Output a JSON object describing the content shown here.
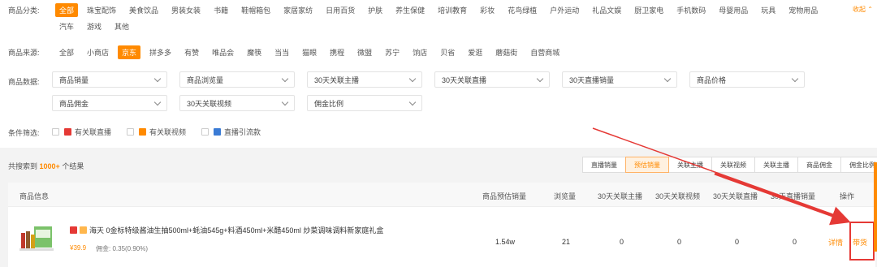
{
  "categories": {
    "label": "商品分类:",
    "row1": [
      "全部",
      "珠宝配饰",
      "美食饮品",
      "男装女装",
      "书籍",
      "鞋帽箱包",
      "家居家纺",
      "日用百货",
      "护肤",
      "养生保健",
      "培训教育",
      "彩妆",
      "花鸟绿植",
      "户外运动",
      "礼品文娱",
      "厨卫家电",
      "手机数码",
      "母婴用品",
      "玩具",
      "宠物用品"
    ],
    "row2": [
      "汽车",
      "游戏",
      "其他"
    ],
    "collapse": "收起 ⌃"
  },
  "sources": {
    "label": "商品来源:",
    "items": [
      "全部",
      "小商店",
      "京东",
      "拼多多",
      "有赞",
      "唯品会",
      "魔筷",
      "当当",
      "猫眼",
      "携程",
      "微盟",
      "苏宁",
      "饷店",
      "贝省",
      "爱逛",
      "蘑菇街",
      "自营商城"
    ]
  },
  "data_filters": {
    "label": "商品数据:",
    "selects": [
      "商品销量",
      "商品浏览量",
      "30天关联主播",
      "30天关联直播",
      "30天直播销量",
      "商品价格",
      "商品佣金",
      "30天关联视频",
      "佣金比例"
    ]
  },
  "conditions": {
    "label": "条件筛选:",
    "items": [
      "有关联直播",
      "有关联视频",
      "直播引流款"
    ]
  },
  "result": {
    "prefix": "共搜索到",
    "count": "1000+",
    "suffix": "个结果"
  },
  "sort_tabs": [
    "直播销量",
    "预估销量",
    "关联主播",
    "关联视频",
    "关联主播",
    "商品佣金",
    "佣金比例"
  ],
  "table": {
    "headers": [
      "商品信息",
      "商品预估销量",
      "浏览量",
      "30天关联主播",
      "30天关联视频",
      "30天关联直播",
      "30天直播销量",
      "操作"
    ],
    "row": {
      "title": "海天 0金标特级酱油生抽500ml+蚝油545g+料酒450ml+米醋450ml 炒菜调味调料新家庭礼盒",
      "price": "¥39.9",
      "commission": "佣金: 0.35(0.90%)",
      "sales": "1.54w",
      "views": "21",
      "anchors": "0",
      "videos": "0",
      "lives": "0",
      "live_sales": "0",
      "detail": "详情",
      "carry": "带货"
    }
  },
  "colors": {
    "accent": "#ff8a00",
    "highlight": "#e53935"
  }
}
